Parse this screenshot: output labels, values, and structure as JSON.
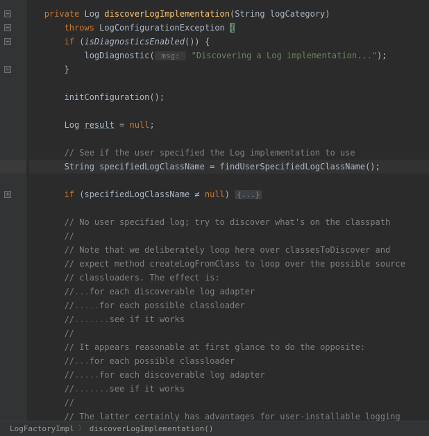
{
  "code": {
    "l0_private": "private",
    "l0_type": " Log ",
    "l0_method": "discoverLogImplementation",
    "l0_params": "(String logCategory)",
    "l1_throws": "throws",
    "l1_ex": " LogConfigurationException ",
    "l1_brace": "{",
    "l2_if": "if",
    "l2_open": " (",
    "l2_call": "isDiagnosticsEnabled",
    "l2_close": "()) {",
    "l3_call": "logDiagnostic",
    "l3_open": "(",
    "l3_hint": " msg: ",
    "l3_str": "\"Discovering a Log implementation...\"",
    "l3_end": ");",
    "l4_close": "}",
    "l6_call": "initConfiguration",
    "l6_end": "();",
    "l8_type": "Log ",
    "l8_var": "result",
    "l8_eq": " = ",
    "l8_null": "null",
    "l8_semi": ";",
    "l10_cmt": "// See if the user specified the Log implementation to use",
    "l11_decl": "String specifiedLogClassName = ",
    "l11_call": "findUserSpecifiedLogClassName",
    "l11_end": "();",
    "l13_if": "if",
    "l13_cond": " (specifiedLogClassName ≠ ",
    "l13_null": "null",
    "l13_close": ") ",
    "l13_fold": "{...}",
    "l15_cmt": "// No user specified log; try to discover what's on the classpath",
    "l16_cmt": "//",
    "l17_cmt": "// Note that we deliberately loop here over classesToDiscover and",
    "l18_cmt": "// expect method createLogFromClass to loop over the possible source",
    "l19_cmt": "// classloaders. The effect is:",
    "l20_cmt": "//",
    "l20_cmt2": "for each discoverable log adapter",
    "l21_cmt": "//",
    "l21_cmt2": "for each possible classloader",
    "l22_cmt": "//",
    "l22_cmt2": "see if it works",
    "l23_cmt": "//",
    "l24_cmt": "// It appears reasonable at first glance to do the opposite:",
    "l25_cmt": "//",
    "l25_cmt2": "for each possible classloader",
    "l26_cmt": "//",
    "l26_cmt2": "for each discoverable log adapter",
    "l27_cmt": "//",
    "l27_cmt2": "see if it works",
    "l28_cmt": "//",
    "l29_cmt": "// The latter certainly has advantages for user-installable logging",
    "dots3": "...",
    "dots5": ".....",
    "dots7": "......."
  },
  "breadcrumb": {
    "class": "LogFactoryImpl",
    "method": "discoverLogImplementation()"
  }
}
